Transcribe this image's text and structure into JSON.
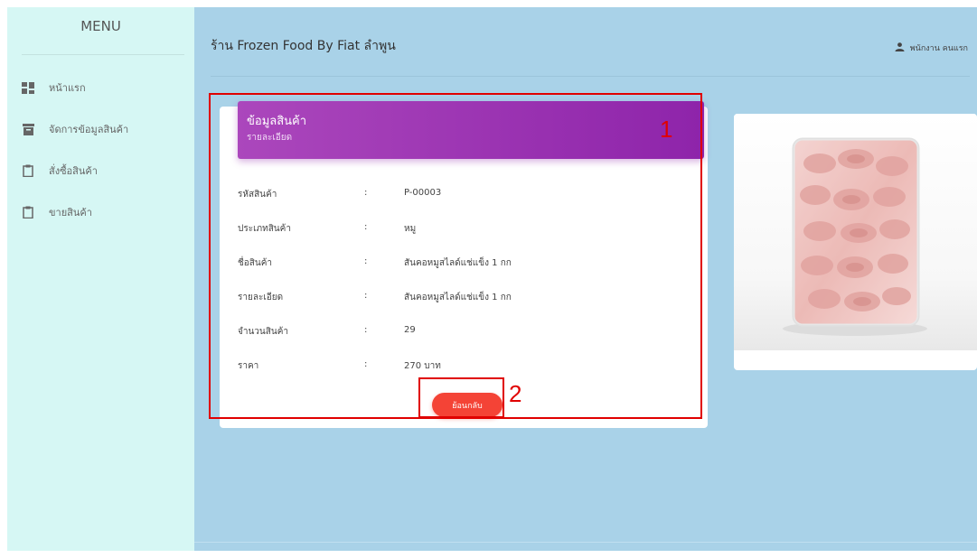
{
  "sidebar": {
    "title": "MENU",
    "items": [
      {
        "label": "หน้าแรก",
        "icon": "dashboard-icon"
      },
      {
        "label": "จัดการข้อมูลสินค้า",
        "icon": "archive-icon"
      },
      {
        "label": "สั่งซื้อสินค้า",
        "icon": "clipboard-icon"
      },
      {
        "label": "ขายสินค้า",
        "icon": "clipboard-icon"
      }
    ]
  },
  "topbar": {
    "title": "ร้าน Frozen Food By Fiat ลำพูน",
    "user": "พนักงาน คนแรก"
  },
  "card": {
    "title": "ข้อมูลสินค้า",
    "subtitle": "รายละเอียด",
    "rows": [
      {
        "label": "รหัสสินค้า",
        "sep": ":",
        "value": "P-00003"
      },
      {
        "label": "ประเภทสินค้า",
        "sep": ":",
        "value": "หมู"
      },
      {
        "label": "ชื่อสินค้า",
        "sep": ":",
        "value": "สันคอหมูสไลด์แช่แข็ง 1 กก"
      },
      {
        "label": "รายละเอียด",
        "sep": ":",
        "value": "สันคอหมูสไลด์แช่แข็ง 1 กก"
      },
      {
        "label": "จำนวนสินค้า",
        "sep": ":",
        "value": "29"
      },
      {
        "label": "ราคา",
        "sep": ":",
        "value": "270 บาท"
      }
    ],
    "back_button": "ย้อนกลับ"
  },
  "annotations": {
    "label_1": "1",
    "label_2": "2"
  },
  "colors": {
    "sidebar_bg": "#d6f7f4",
    "main_bg": "#a9d2e8",
    "header_gradient_start": "#ab47bc",
    "header_gradient_end": "#8e24aa",
    "button": "#f44336",
    "annotation": "#e00000"
  }
}
